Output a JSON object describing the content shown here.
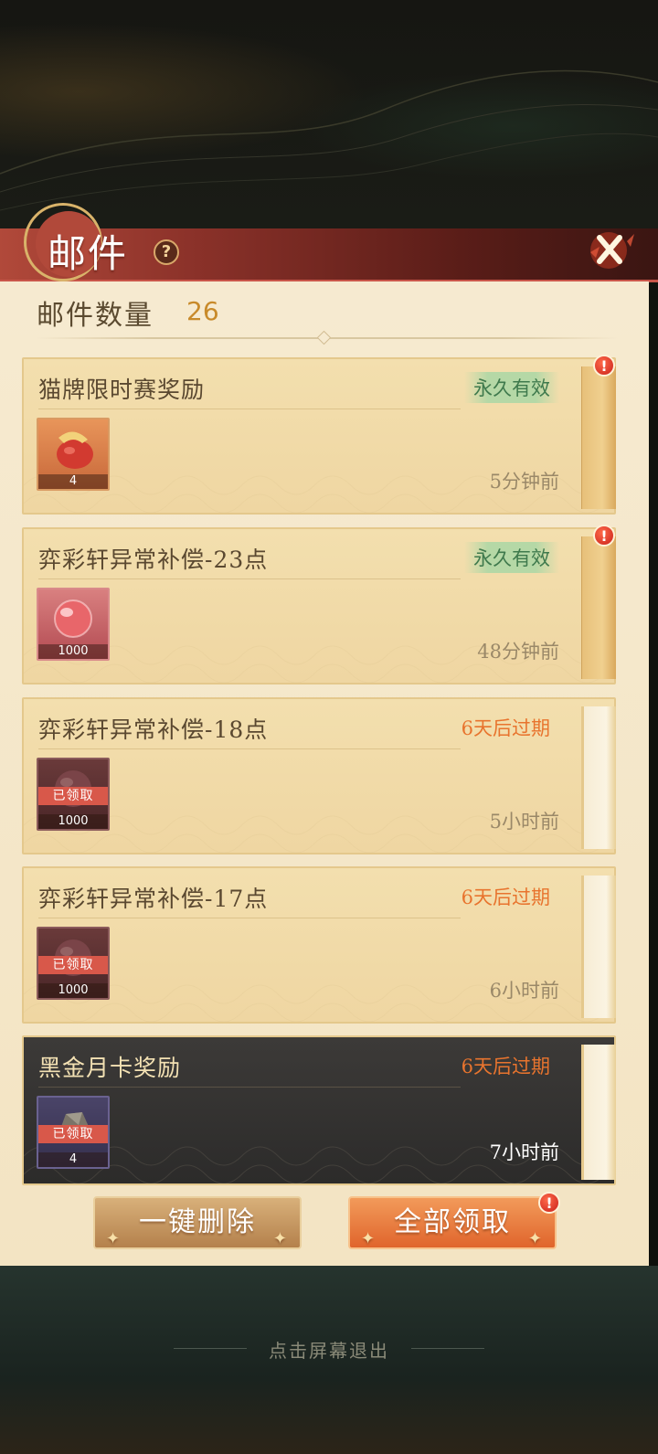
{
  "header": {
    "title": "邮件",
    "help_symbol": "?",
    "close_symbol": "✕"
  },
  "mail_count": {
    "label": "邮件数量",
    "value": "26"
  },
  "mails": [
    {
      "title": "猫牌限时赛奖励",
      "validity": "永久有效",
      "time": "5分钟前",
      "item": {
        "icon": "red-lantern-icon",
        "quantity": "4",
        "claimed": false
      },
      "unread": true
    },
    {
      "title": "弈彩轩异常补偿-23点",
      "validity": "永久有效",
      "time": "48分钟前",
      "item": {
        "icon": "red-orb-icon",
        "quantity": "1000",
        "claimed": false
      },
      "unread": true
    },
    {
      "title": "弈彩轩异常补偿-18点",
      "validity": "6天后过期",
      "time": "5小时前",
      "item": {
        "icon": "red-orb-icon",
        "quantity": "1000",
        "claimed": true,
        "claimed_label": "已领取"
      },
      "unread": false
    },
    {
      "title": "弈彩轩异常补偿-17点",
      "validity": "6天后过期",
      "time": "6小时前",
      "item": {
        "icon": "red-orb-icon",
        "quantity": "1000",
        "claimed": true,
        "claimed_label": "已领取"
      },
      "unread": false
    },
    {
      "title": "黑金月卡奖励",
      "validity": "6天后过期",
      "time": "7小时前",
      "item": {
        "icon": "stone-icon",
        "quantity": "4",
        "claimed": true,
        "claimed_label": "已领取"
      },
      "unread": false
    }
  ],
  "buttons": {
    "delete_all": "一键删除",
    "claim_all": "全部领取"
  },
  "alert_symbol": "!",
  "exit_hint": "点击屏幕退出",
  "colors": {
    "header_red": "#b1493a",
    "panel_bg": "#f6ead0",
    "permanent_green": "#3f7a4d",
    "expire_orange": "#e8742e",
    "claim_button": "#e0652c"
  }
}
